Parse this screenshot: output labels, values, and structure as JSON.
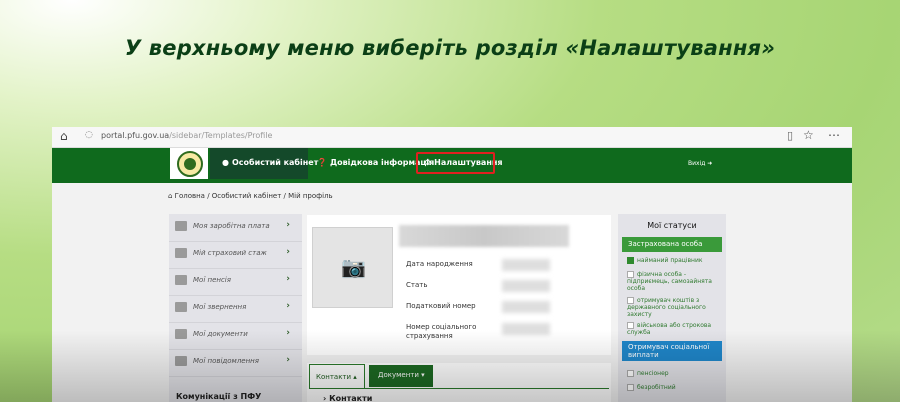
{
  "headline": "У верхньому меню виберіть розділ «Налаштування»",
  "browser": {
    "url_main": "portal.pfu.gov.ua",
    "url_path": "/sidebar/Templates/Profile"
  },
  "nav": {
    "items": [
      {
        "label": "Особистий кабінет",
        "icon": "user-icon"
      },
      {
        "label": "Довідкова інформація",
        "icon": "question-icon"
      },
      {
        "label": "Налаштування",
        "icon": "gear-icon"
      }
    ],
    "exit_label": "Вихід ➜"
  },
  "breadcrumb": "Головна / Особистий кабінет / Мій профіль",
  "sidebar": {
    "items": [
      {
        "label": "Моя заробітна плата"
      },
      {
        "label": "Мій страховий стаж"
      },
      {
        "label": "Мої пенсія"
      },
      {
        "label": "Мої звернення"
      },
      {
        "label": "Мої документи"
      },
      {
        "label": "Мої повідомлення"
      }
    ],
    "heading": "Комунікації з ПФУ"
  },
  "profile": {
    "fields": [
      {
        "label": "Дата народження"
      },
      {
        "label": "Стать"
      },
      {
        "label": "Податковий номер"
      },
      {
        "label": "Номер соціального"
      },
      {
        "label": "страхування"
      }
    ]
  },
  "tabs": {
    "contacts": "Контакти ▴",
    "documents": "Документи ▾",
    "sub_heading": "› Контакти"
  },
  "statuses": {
    "title": "Мої статуси",
    "group1": "Застрахована особа",
    "group1_items": [
      {
        "label": "найманий працівник",
        "checked": true
      },
      {
        "label": "фізична особа - підприємець, самозайнята особа",
        "checked": false
      },
      {
        "label": "отримувач коштів з державного соціального захисту",
        "checked": false
      },
      {
        "label": "військова або строкова служба",
        "checked": false
      }
    ],
    "group2": "Отримувач соціальної виплати",
    "group2_items": [
      {
        "label": "пенсіонер",
        "checked": false
      },
      {
        "label": "безробітний",
        "checked": false
      }
    ]
  },
  "colors": {
    "nav_green": "#0f6a1d",
    "nav_active": "#14492a",
    "highlight_red": "#e02020",
    "status_green": "#3a9a3a",
    "status_blue": "#1f86c9"
  }
}
